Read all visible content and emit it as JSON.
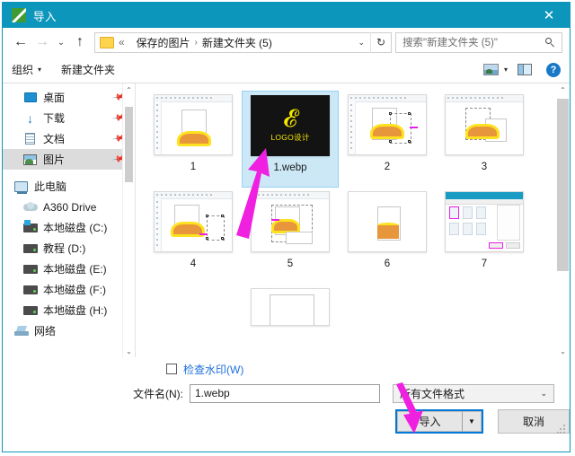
{
  "window": {
    "title": "导入",
    "app_icon": "green-pen-icon",
    "close_label": "✕",
    "accent_color": "#0c96bc",
    "focus_color": "#0078d7"
  },
  "nav": {
    "back_label": "←",
    "forward_label": "→",
    "recent_label": "⌄",
    "up_label": "↑",
    "breadcrumb": {
      "overflow": "«",
      "parts": [
        "保存的图片",
        "新建文件夹 (5)"
      ],
      "separator": "›",
      "caret": "⌄"
    },
    "refresh_label": "↻"
  },
  "search": {
    "placeholder": "搜索\"新建文件夹 (5)\""
  },
  "toolbar": {
    "organize_label": "组织",
    "organize_caret": "▾",
    "new_folder_label": "新建文件夹",
    "view_caret": "▾",
    "view_icon": "thumbnail-view-icon",
    "pane_icon": "preview-pane-icon",
    "help_label": "?"
  },
  "sidebar": {
    "items": [
      {
        "label": "桌面",
        "icon": "desktop-icon",
        "pinned": true,
        "selected": false,
        "indent": 1
      },
      {
        "label": "下载",
        "icon": "download-icon",
        "pinned": true,
        "selected": false,
        "indent": 1
      },
      {
        "label": "文档",
        "icon": "documents-icon",
        "pinned": true,
        "selected": false,
        "indent": 1
      },
      {
        "label": "图片",
        "icon": "pictures-icon",
        "pinned": true,
        "selected": true,
        "indent": 1
      },
      {
        "label": "此电脑",
        "icon": "this-pc-icon",
        "pinned": false,
        "selected": false,
        "indent": 0
      },
      {
        "label": "A360 Drive",
        "icon": "cloud-drive-icon",
        "pinned": false,
        "selected": false,
        "indent": 1
      },
      {
        "label": "本地磁盘 (C:)",
        "icon": "system-drive-icon",
        "pinned": false,
        "selected": false,
        "indent": 1
      },
      {
        "label": "教程 (D:)",
        "icon": "drive-icon",
        "pinned": false,
        "selected": false,
        "indent": 1
      },
      {
        "label": "本地磁盘 (E:)",
        "icon": "drive-icon",
        "pinned": false,
        "selected": false,
        "indent": 1
      },
      {
        "label": "本地磁盘 (F:)",
        "icon": "drive-icon",
        "pinned": false,
        "selected": false,
        "indent": 1
      },
      {
        "label": "本地磁盘 (H:)",
        "icon": "drive-icon",
        "pinned": false,
        "selected": false,
        "indent": 1
      },
      {
        "label": "网络",
        "icon": "network-icon",
        "pinned": false,
        "selected": false,
        "indent": 0
      }
    ],
    "pin_glyph": "📌",
    "scroll_up": "⌃",
    "scroll_down": "⌄"
  },
  "files": {
    "items": [
      {
        "name": "1",
        "kind": "screenshot",
        "selected": false
      },
      {
        "name": "1.webp",
        "kind": "logo",
        "selected": true
      },
      {
        "name": "2",
        "kind": "screenshot",
        "selected": false
      },
      {
        "name": "3",
        "kind": "screenshot",
        "selected": false
      },
      {
        "name": "4",
        "kind": "screenshot",
        "selected": false
      },
      {
        "name": "5",
        "kind": "screenshot",
        "selected": false
      },
      {
        "name": "6",
        "kind": "plain",
        "selected": false
      },
      {
        "name": "7",
        "kind": "dialog",
        "selected": false
      }
    ],
    "logo_mark": "𝓔",
    "logo_caption": "LOGO设计",
    "scroll_up": "⌃",
    "scroll_down": "⌄"
  },
  "bottom": {
    "watermark_checkbox_label": "检查水印(W)",
    "watermark_checked": false,
    "filename_label": "文件名(N):",
    "filename_value": "1.webp",
    "filter_value": "所有文件格式",
    "filter_caret": "⌄",
    "import_label": "导入",
    "import_split_caret": "▼",
    "cancel_label": "取消"
  },
  "annotations": {
    "arrow_color": "#f020e0",
    "arrows": [
      {
        "name": "arrow-to-selected-file",
        "points_to": "1.webp"
      },
      {
        "name": "arrow-to-import-button",
        "points_to": "导入"
      }
    ]
  }
}
